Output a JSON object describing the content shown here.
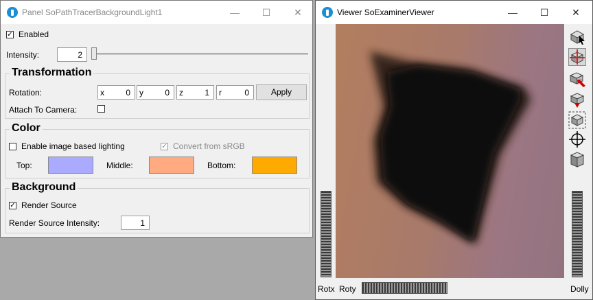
{
  "panel": {
    "title": "Panel SoPathTracerBackgroundLight1",
    "enabled_label": "Enabled",
    "enabled_checked": true,
    "intensity_label": "Intensity:",
    "intensity_value": "2",
    "transformation": {
      "title": "Transformation",
      "rotation_label": "Rotation:",
      "x_label": "x",
      "x_value": "0",
      "y_label": "y",
      "y_value": "0",
      "z_label": "z",
      "z_value": "1",
      "r_label": "r",
      "r_value": "0",
      "apply_label": "Apply",
      "attach_label": "Attach To Camera:",
      "attach_checked": false
    },
    "color": {
      "title": "Color",
      "ibl_label": "Enable image based lighting",
      "ibl_checked": false,
      "srgb_label": "Convert from sRGB",
      "srgb_checked": true,
      "srgb_disabled": true,
      "top_label": "Top:",
      "top_color": "#aaaaff",
      "middle_label": "Middle:",
      "middle_color": "#ffaa80",
      "bottom_label": "Bottom:",
      "bottom_color": "#ffaa00"
    },
    "background": {
      "title": "Background",
      "render_source_label": "Render Source",
      "render_source_checked": true,
      "render_intensity_label": "Render Source Intensity:",
      "render_intensity_value": "1"
    }
  },
  "viewer": {
    "title": "Viewer SoExaminerViewer",
    "rotx_label": "Rotx",
    "roty_label": "Roty",
    "dolly_label": "Dolly",
    "tools": [
      "pick-arrow-icon",
      "view-rotate-icon",
      "home-icon",
      "set-home-icon",
      "view-all-icon",
      "seek-icon",
      "projection-cube-icon"
    ]
  },
  "window_controls": {
    "minimize": "—",
    "maximize": "☐",
    "close": "✕"
  }
}
